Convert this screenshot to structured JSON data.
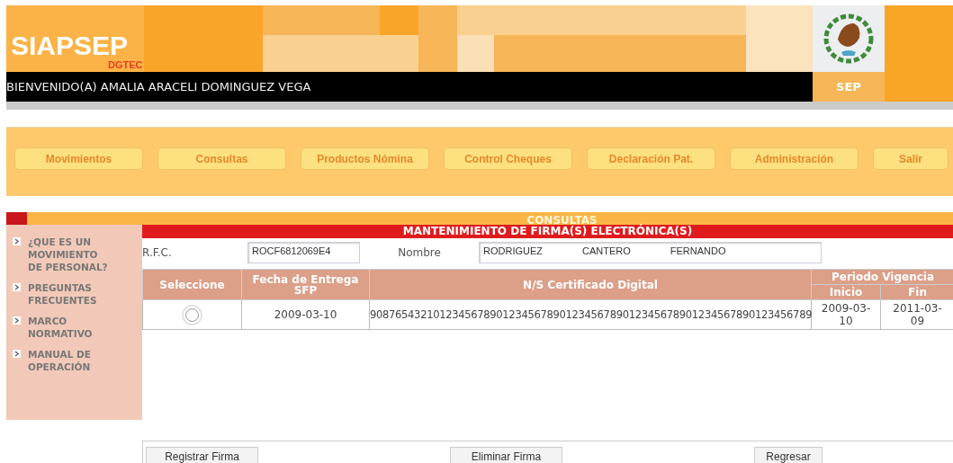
{
  "header": {
    "logo": "SIAPSEP",
    "sublogo": "DGTEC",
    "welcome": "BIENVENIDO(A) AMALIA ARACELI DOMINGUEZ VEGA",
    "agency": "SEP"
  },
  "menu": [
    "Movimientos",
    "Consultas",
    "Productos Nómina",
    "Control Cheques",
    "Declaración Pat.",
    "Administración",
    "Salir"
  ],
  "section_title": "CONSULTAS",
  "sidebar": {
    "items": [
      "¿QUE ES UN MOVIMIENTO DE PERSONAL?",
      "PREGUNTAS FRECUENTES",
      "MARCO NORMATIVO",
      "MANUAL DE OPERACIÓN"
    ]
  },
  "panel": {
    "title": "MANTENIMIENTO DE FIRMA(S) ELECTRÓNICA(S)",
    "rfc_label": "R.F.C.",
    "rfc_value": "ROCF6812069E4",
    "name_label": "Nombre",
    "name_parts": [
      "RODRIGUEZ",
      "CANTERO",
      "FERNANDO"
    ]
  },
  "table": {
    "columns": [
      "Seleccione",
      "Fecha de Entrega SFP",
      "N/S Certificado Digital"
    ],
    "group": {
      "label": "Periodo Vigencia",
      "columns": [
        "Inicio",
        "Fin"
      ]
    },
    "rows": [
      {
        "selected": false,
        "cells": [
          "",
          "2009-03-10",
          "9087654321012345678901234567890123456789012345678901234567890123456789",
          "2009-03-10",
          "2011-03-09"
        ]
      }
    ]
  },
  "buttons": [
    "Registrar Firma",
    "Eliminar Firma",
    "Regresar"
  ]
}
